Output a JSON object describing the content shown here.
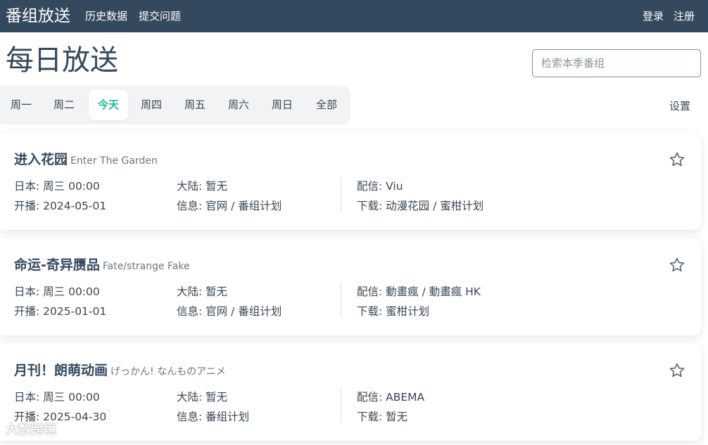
{
  "navbar": {
    "brand": "番组放送",
    "links": [
      "历史数据",
      "提交问题"
    ],
    "login": "登录",
    "register": "注册"
  },
  "header": {
    "title": "每日放送",
    "search_placeholder": "检索本季番组"
  },
  "tabs": [
    "周一",
    "周二",
    "今天",
    "周四",
    "周五",
    "周六",
    "周日",
    "全部"
  ],
  "active_tab": "今天",
  "settings_label": "设置",
  "cards": [
    {
      "title": "进入花园",
      "subtitle": "Enter The Garden",
      "japan": "日本: 周三 00:00",
      "mainland": "大陆: 暂无",
      "streaming": "配信: Viu",
      "premiere": "开播: 2024-05-01",
      "info": "信息: 官网 / 番组计划",
      "download": "下载: 动漫花园 / 蜜柑计划"
    },
    {
      "title": "命运-奇异赝品",
      "subtitle": "Fate/strange Fake",
      "japan": "日本: 周三 00:00",
      "mainland": "大陆: 暂无",
      "streaming": "配信: 動畫瘋 / 動畫瘋 HK",
      "premiere": "开播: 2025-01-01",
      "info": "信息: 官网 / 番组计划",
      "download": "下载: 蜜柑计划"
    },
    {
      "title": "月刊！朗萌动画",
      "subtitle": "げっかん! なんものアニメ",
      "japan": "日本: 周三 00:00",
      "mainland": "大陆: 暂无",
      "streaming": "配信: ABEMA",
      "premiere": "开播: 2025-04-30",
      "info": "信息: 番组计划",
      "download": "下载: 暂无"
    }
  ],
  "watermark": "大数跨境",
  "colors": {
    "navbar": "#34495e",
    "accent": "#1abc9c",
    "text": "#3a4652"
  }
}
